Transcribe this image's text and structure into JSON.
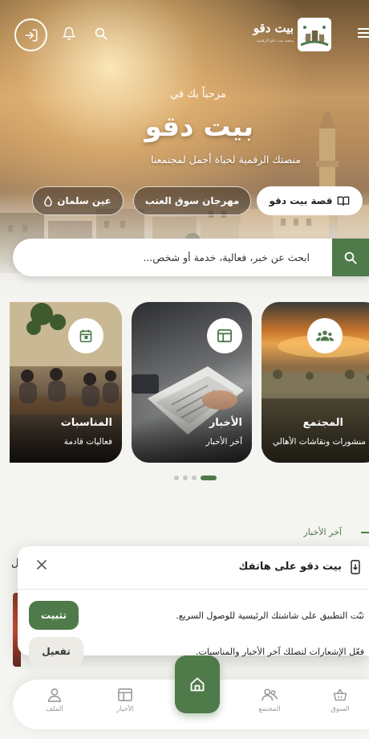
{
  "header": {
    "logo_title": "بيت دقو",
    "logo_subtitle": "منصة بيت دقو الرقمية"
  },
  "hero": {
    "welcome": "مرحباً بك في",
    "title": "بيت دقو",
    "tagline": "منصتك الرقمية لحياة أجمل لمجتمعنا",
    "chips": {
      "story": "قصة بيت دقو",
      "festival": "مهرجان سوق العنب",
      "spring": "عين سلمان"
    }
  },
  "search": {
    "placeholder": "ابحث عن خبر، فعالية، خدمة أو شخص..."
  },
  "cards": {
    "community": {
      "title": "المجتمع",
      "subtitle": "منشورات ونقاشات الأهالي"
    },
    "news": {
      "title": "الأخبار",
      "subtitle": "آخر الأخبار"
    },
    "events": {
      "title": "المناسبات",
      "subtitle": "فعاليات قادمة"
    }
  },
  "carousel": {
    "pages": 4,
    "active": 1
  },
  "section": {
    "latest_news": "آخر الأخبار"
  },
  "install_prompt": {
    "title": "بيت دقو على هاتفك",
    "install_text": "ثبّت التطبيق على شاشتك الرئيسية للوصول السريع.",
    "install_button": "تثبيت",
    "notify_text": "فعّل الإشعارات لتصلك آخر الأخبار والمناسبات.",
    "notify_button": "تفعيل"
  },
  "bottom_nav": {
    "market": "السوق",
    "community": "المجتمع",
    "news": "الأخبار",
    "profile": "الملف"
  },
  "colors": {
    "accent": "#4f7a4a",
    "background": "#f4f4f1"
  }
}
